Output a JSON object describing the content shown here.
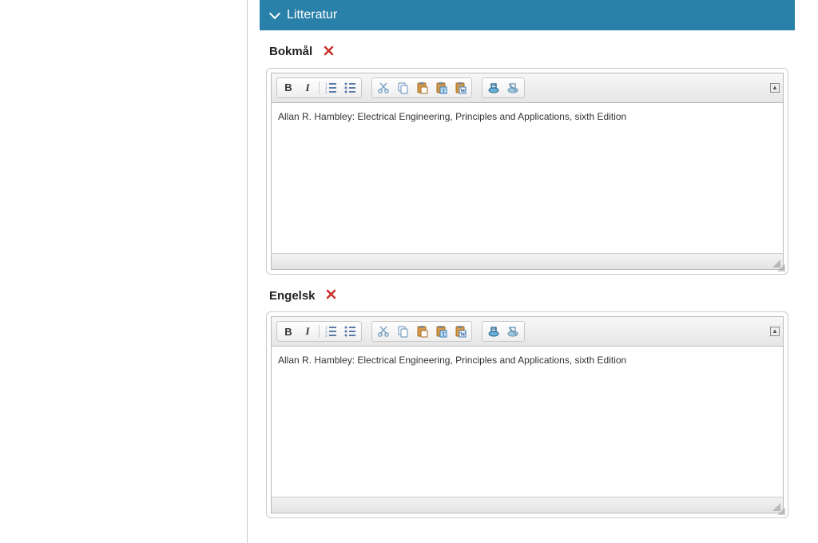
{
  "section": {
    "title": "Litteratur"
  },
  "languages": [
    {
      "key": "bokmal",
      "label": "Bokmål",
      "content": "Allan R. Hambley: Electrical Engineering, Principles and Applications, sixth Edition"
    },
    {
      "key": "engelsk",
      "label": "Engelsk",
      "content": "Allan R. Hambley: Electrical Engineering, Principles and Applications, sixth Edition"
    }
  ],
  "toolbar": {
    "bold": "B",
    "italic": "I"
  }
}
